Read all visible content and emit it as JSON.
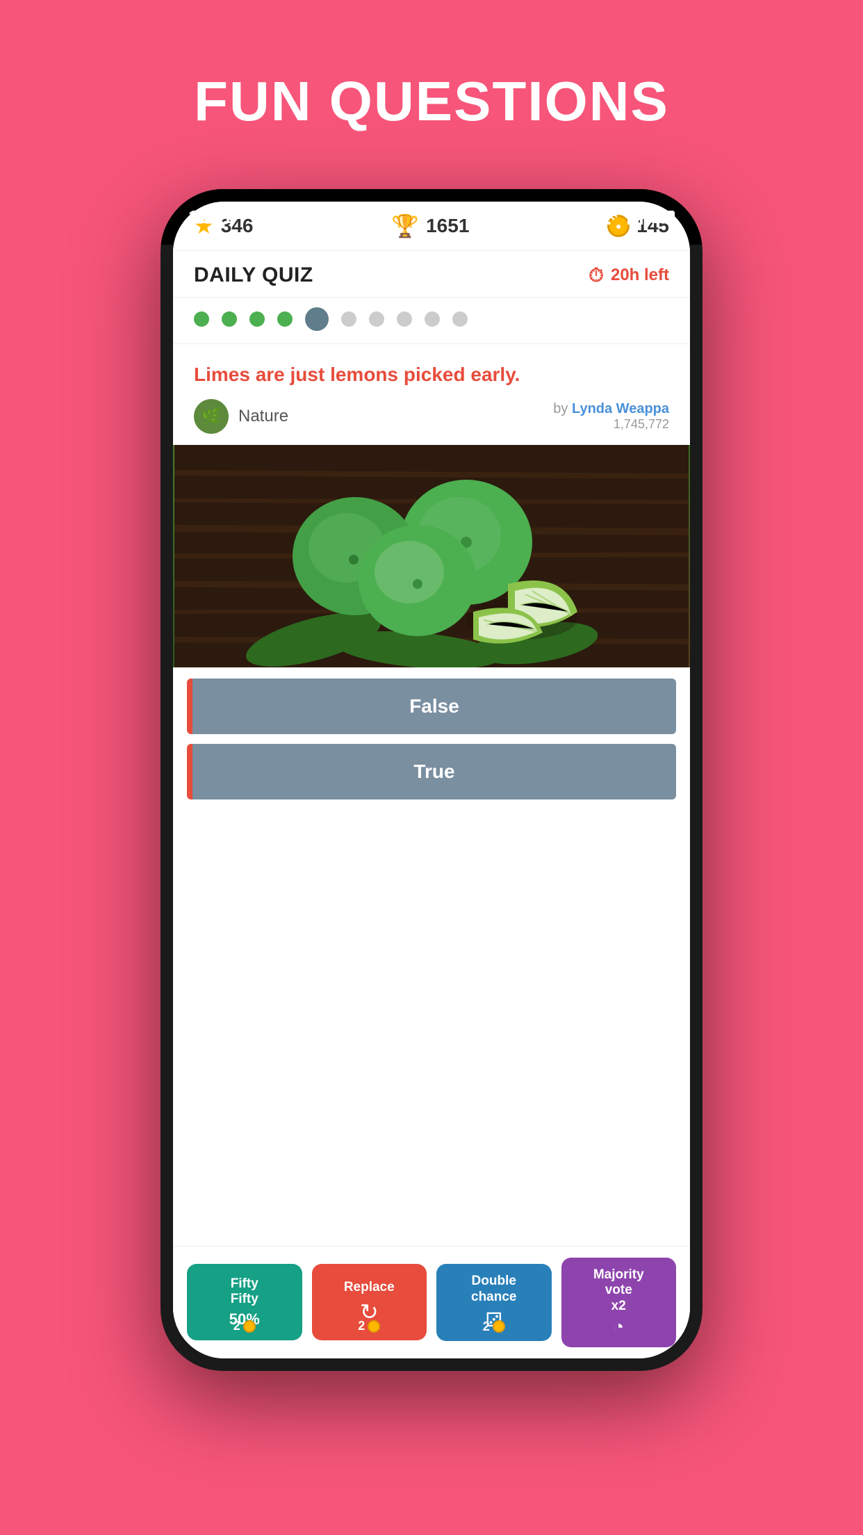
{
  "page": {
    "title": "FUN QUESTIONS",
    "background_color": "#F7557A"
  },
  "status_bar": {
    "time": "11:11"
  },
  "stats": {
    "stars": "346",
    "trophy": "1651",
    "coins": "145"
  },
  "quiz_header": {
    "title": "DAILY QUIZ",
    "timer": "20h left"
  },
  "progress": {
    "dots": [
      "completed",
      "completed",
      "completed",
      "completed",
      "current",
      "pending",
      "pending",
      "pending",
      "pending",
      "pending"
    ]
  },
  "question": {
    "text": "Limes are just lemons picked early.",
    "category": "Nature",
    "author_prefix": "by",
    "author_name": "Lynda Weappa",
    "author_count": "1,745,772"
  },
  "answers": [
    {
      "label": "False"
    },
    {
      "label": "True"
    }
  ],
  "powerups": [
    {
      "id": "fifty-fifty",
      "label": "Fifty\nFifty",
      "icon": "50%",
      "count": "2",
      "color": "#16A085"
    },
    {
      "id": "replace",
      "label": "Replace",
      "icon": "↻",
      "count": "2",
      "color": "#E74C3C"
    },
    {
      "id": "double-chance",
      "label": "Double\nchance",
      "icon": "⚂",
      "count": "2",
      "color": "#2980B9"
    },
    {
      "id": "majority-vote",
      "label": "Majority\nvote\nx2",
      "icon": "◔",
      "count": null,
      "color": "#8E44AD"
    }
  ]
}
